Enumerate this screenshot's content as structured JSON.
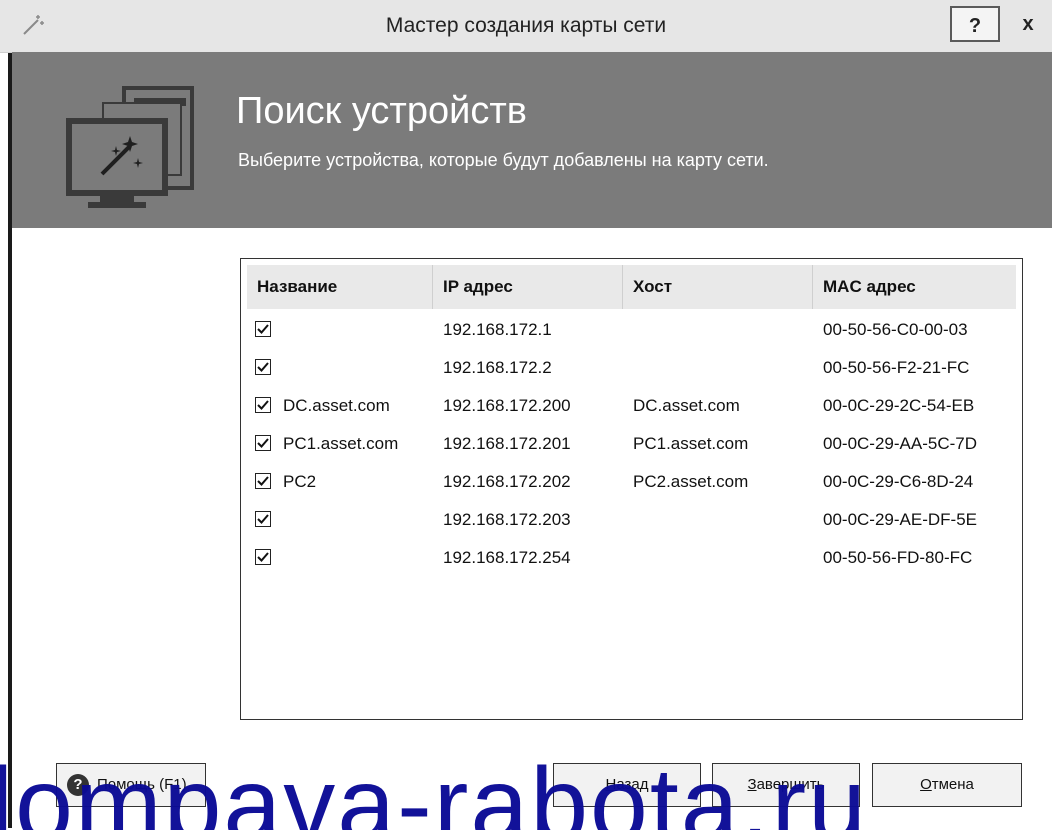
{
  "window": {
    "title": "Мастер создания карты сети",
    "help_glyph": "?",
    "close_glyph": "x"
  },
  "banner": {
    "title": "Поиск устройств",
    "subtitle": "Выберите устройства, которые будут добавлены на карту сети."
  },
  "table": {
    "headers": [
      "Название",
      "IP адрес",
      "Хост",
      "MAC адрес"
    ],
    "rows": [
      {
        "checked": true,
        "name": "",
        "ip": "192.168.172.1",
        "host": "",
        "mac": "00-50-56-C0-00-03"
      },
      {
        "checked": true,
        "name": "",
        "ip": "192.168.172.2",
        "host": "",
        "mac": "00-50-56-F2-21-FC"
      },
      {
        "checked": true,
        "name": "DC.asset.com",
        "ip": "192.168.172.200",
        "host": "DC.asset.com",
        "mac": "00-0C-29-2C-54-EB"
      },
      {
        "checked": true,
        "name": "PC1.asset.com",
        "ip": "192.168.172.201",
        "host": "PC1.asset.com",
        "mac": "00-0C-29-AA-5C-7D"
      },
      {
        "checked": true,
        "name": "PC2",
        "ip": "192.168.172.202",
        "host": "PC2.asset.com",
        "mac": "00-0C-29-C6-8D-24"
      },
      {
        "checked": true,
        "name": "",
        "ip": "192.168.172.203",
        "host": "",
        "mac": "00-0C-29-AE-DF-5E"
      },
      {
        "checked": true,
        "name": "",
        "ip": "192.168.172.254",
        "host": "",
        "mac": "00-50-56-FD-80-FC"
      }
    ]
  },
  "buttons": {
    "help_key": "П",
    "help_rest": "омощь (F1)",
    "back_key": "Н",
    "back_rest": "азад",
    "finish_key": "З",
    "finish_rest": "авершить",
    "cancel_key": "О",
    "cancel_rest": "тмена"
  },
  "watermark": {
    "text": "lompava-rabota.ru"
  },
  "icons": {
    "title": "magic-wand-icon",
    "banner": "monitor-wizard-icon",
    "help": "help-icon",
    "checkbox": "checkmark-icon"
  },
  "colors": {
    "banner_bg": "#7b7b7b",
    "watermark": "#0b0b96"
  }
}
